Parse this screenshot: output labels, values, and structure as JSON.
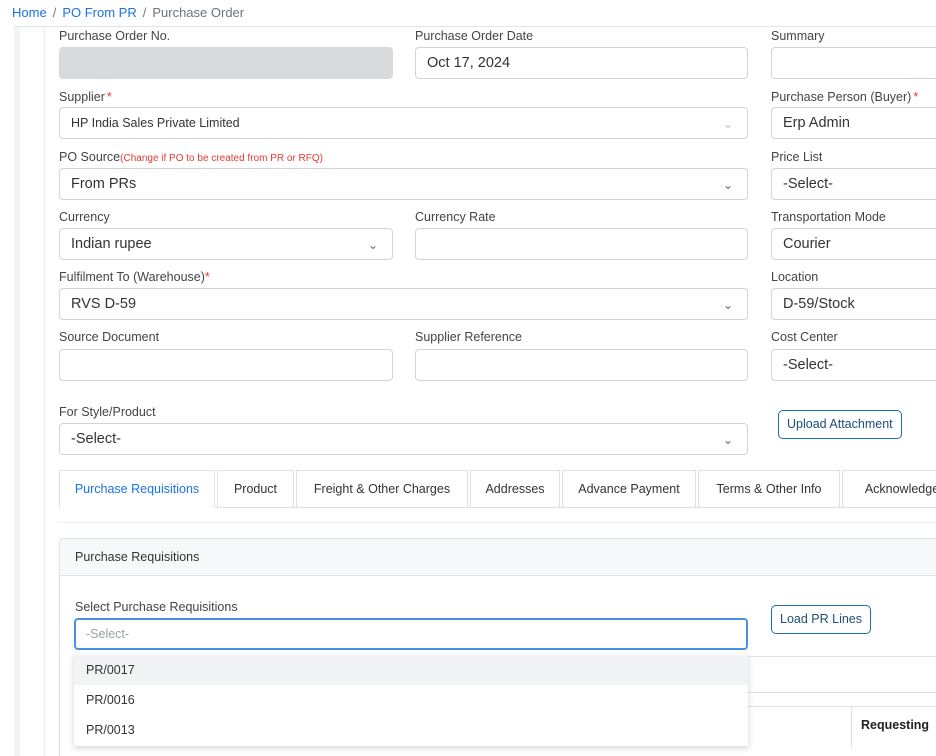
{
  "breadcrumb": {
    "items": [
      "Home",
      "PO From PR"
    ],
    "current": "Purchase Order"
  },
  "form": {
    "po_no": {
      "label": "Purchase Order No.",
      "value": ""
    },
    "po_date": {
      "label": "Purchase Order Date",
      "value": "Oct 17, 2024"
    },
    "summary": {
      "label": "Summary",
      "value": ""
    },
    "supplier": {
      "label": "Supplier",
      "required_mark": "*",
      "value": "HP India Sales Private Limited"
    },
    "buyer": {
      "label": "Purchase Person (Buyer)",
      "required_mark": "*",
      "value": "Erp Admin"
    },
    "po_source": {
      "label": "PO Source",
      "hint": "(Change if PO to be created from PR or RFQ)",
      "value": "From PRs"
    },
    "price_list": {
      "label": "Price List",
      "value": "-Select-"
    },
    "currency": {
      "label": "Currency",
      "value": "Indian rupee"
    },
    "currency_rate": {
      "label": "Currency Rate",
      "value": ""
    },
    "transport_mode": {
      "label": "Transportation Mode",
      "value": "Courier"
    },
    "fulfilment": {
      "label": "Fulfilment To (Warehouse)",
      "required_mark": "*",
      "value": "RVS D-59"
    },
    "location": {
      "label": "Location",
      "value": "D-59/Stock"
    },
    "source_document": {
      "label": "Source Document",
      "value": ""
    },
    "supplier_reference": {
      "label": "Supplier Reference",
      "value": ""
    },
    "cost_center": {
      "label": "Cost Center",
      "value": "-Select-"
    },
    "style_product": {
      "label": "For Style/Product",
      "value": "-Select-"
    },
    "upload_attachment": "Upload Attachment"
  },
  "tabs": [
    "Purchase Requisitions",
    "Product",
    "Freight & Other Charges",
    "Addresses",
    "Advance Payment",
    "Terms & Other Info",
    "Acknowledge"
  ],
  "active_tab": "Purchase Requisitions",
  "pr_panel": {
    "title": "Purchase Requisitions",
    "select_label": "Select Purchase Requisitions",
    "select_placeholder": "-Select-",
    "load_button": "Load PR Lines",
    "options": [
      "PR/0017",
      "PR/0016",
      "PR/0013"
    ],
    "column_header": "Requesting"
  },
  "colors": {
    "link": "#1a73e8",
    "required": "#e53935",
    "focus_border": "#4a90e2",
    "button_border": "#1c6fa6"
  }
}
